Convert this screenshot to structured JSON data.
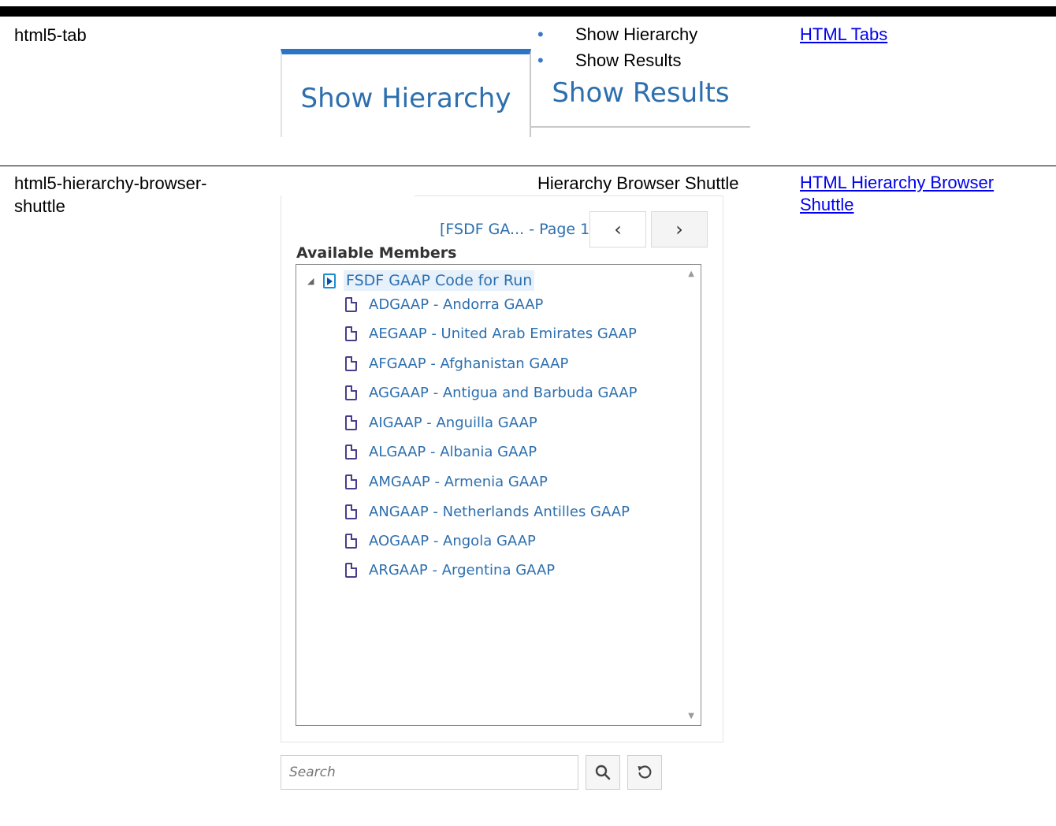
{
  "rows": [
    {
      "name": "html5-tab",
      "description_items": [
        "Show Hierarchy",
        "Show Results"
      ],
      "link": "HTML Tabs"
    },
    {
      "name": "html5-hierarchy-browser-shuttle",
      "description": "Hierarchy Browser Shuttle",
      "link": "HTML Hierarchy Browser Shuttle"
    }
  ],
  "tabs_image": {
    "tabs": [
      {
        "label": "Show Hierarchy",
        "active": true
      },
      {
        "label": "Show Results",
        "active": false
      }
    ]
  },
  "hierarchy_image": {
    "page_text": "[FSDF GA... - Page 1",
    "prev_glyph": "‹",
    "next_glyph": "›",
    "panel_title": "Available Members",
    "root": "FSDF GAAP Code for Run",
    "members": [
      "ADGAAP - Andorra GAAP",
      "AEGAAP - United Arab Emirates GAAP",
      "AFGAAP - Afghanistan GAAP",
      "AGGAAP - Antigua and Barbuda GAAP",
      "AIGAAP - Anguilla GAAP",
      "ALGAAP - Albania GAAP",
      "AMGAAP - Armenia GAAP",
      "ANGAAP - Netherlands Antilles GAAP",
      "AOGAAP - Angola GAAP",
      "ARGAAP - Argentina GAAP"
    ],
    "search_placeholder": "Search"
  },
  "colors": {
    "tab_accent": "#2a76c6",
    "link_text": "#2d6fae",
    "doc_icon": "#4b3c8a"
  }
}
